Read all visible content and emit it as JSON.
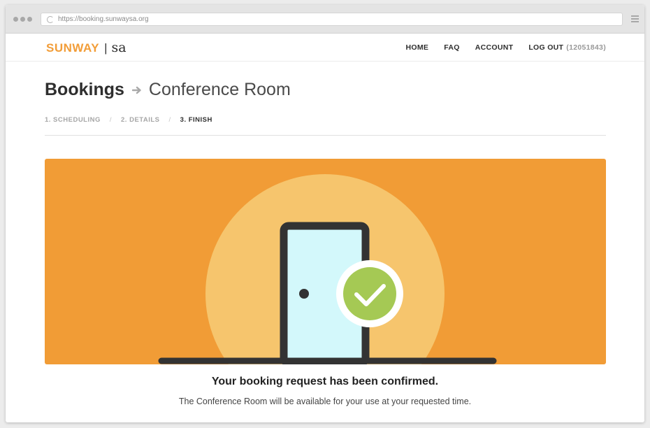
{
  "browser": {
    "url": "https://booking.sunwaysa.org"
  },
  "header": {
    "logo_main": "SUNWAY",
    "logo_separator": "|",
    "logo_sa": "sa",
    "nav": {
      "home": "HOME",
      "faq": "FAQ",
      "account": "ACCOUNT",
      "logout": "LOG OUT",
      "account_id": "(12051843)"
    }
  },
  "page": {
    "title": "Bookings",
    "subtitle": "Conference Room"
  },
  "steps": [
    {
      "label": "1. SCHEDULING",
      "active": false
    },
    {
      "label": "2. DETAILS",
      "active": false
    },
    {
      "label": "3. FINISH",
      "active": true
    }
  ],
  "step_separator": "/",
  "confirmation": {
    "title": "Your booking request has been confirmed.",
    "message": "The Conference Room will be available for your use at your requested time."
  },
  "colors": {
    "brand": "#f29d38",
    "hero_bg": "#f19c36",
    "sun": "#f6c56d",
    "door": "#d3f8fb",
    "check": "#a5c954",
    "frame": "#333333"
  },
  "icons": [
    "reload-icon",
    "menu-icon",
    "arrow-right-icon",
    "door-icon",
    "checkmark-icon"
  ]
}
